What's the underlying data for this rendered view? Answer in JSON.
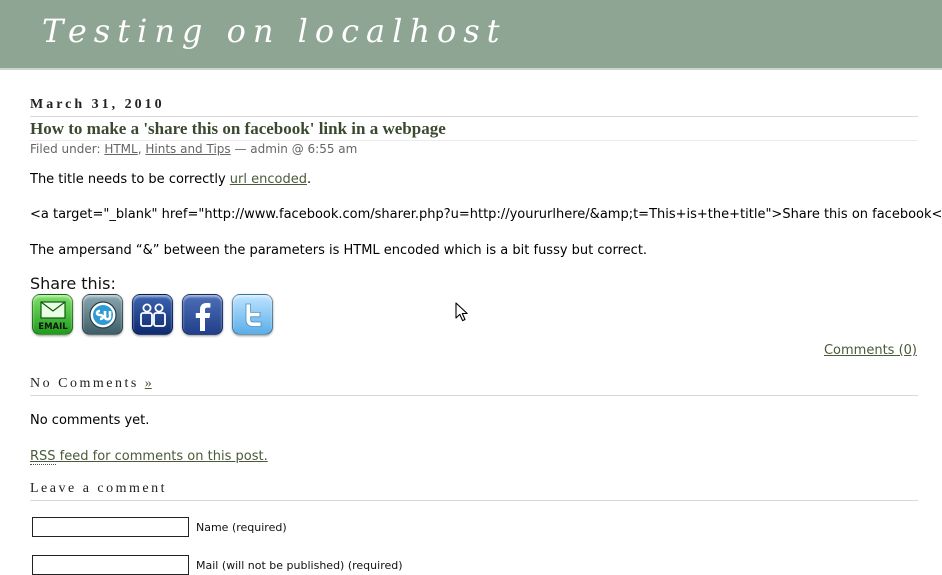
{
  "site": {
    "title": "Testing on localhost"
  },
  "post": {
    "date": "March 31, 2010",
    "title": "How to make a 'share this on facebook' link in a webpage",
    "meta": {
      "prefix": "Filed under: ",
      "categories": [
        "HTML",
        "Hints and Tips"
      ],
      "separator": ", ",
      "suffix": " — admin @ 6:55 am"
    },
    "para1": {
      "before": "The title needs to be correctly ",
      "link": "url encoded",
      "after": "."
    },
    "code_line": "<a target=\"_blank\" href=\"http://www.facebook.com/sharer.php?u=http://yoururlhere/&amp;t=This+is+the+title\">Share this on facebook</a>",
    "para3": "The ampersand “&” between the parameters is HTML encoded which is a bit fussy but correct."
  },
  "share": {
    "label": "Share this:",
    "email_text": "EMAIL",
    "icons": [
      "email-icon",
      "stumbleupon-icon",
      "myspace-icon",
      "facebook-icon",
      "twitter-icon"
    ]
  },
  "comments": {
    "link": "Comments (0)",
    "heading": "No Comments",
    "heading_link": "»",
    "none_text": "No comments yet.",
    "rss_abbr": "RSS",
    "rss_rest": " feed for comments on this post."
  },
  "comment_form": {
    "heading": "Leave a comment",
    "name_label": "Name (required)",
    "name_value": "",
    "mail_label": "Mail (will not be published) (required)",
    "mail_value": ""
  },
  "colors": {
    "header_bg": "#8da592",
    "link": "#4a5a3a"
  }
}
